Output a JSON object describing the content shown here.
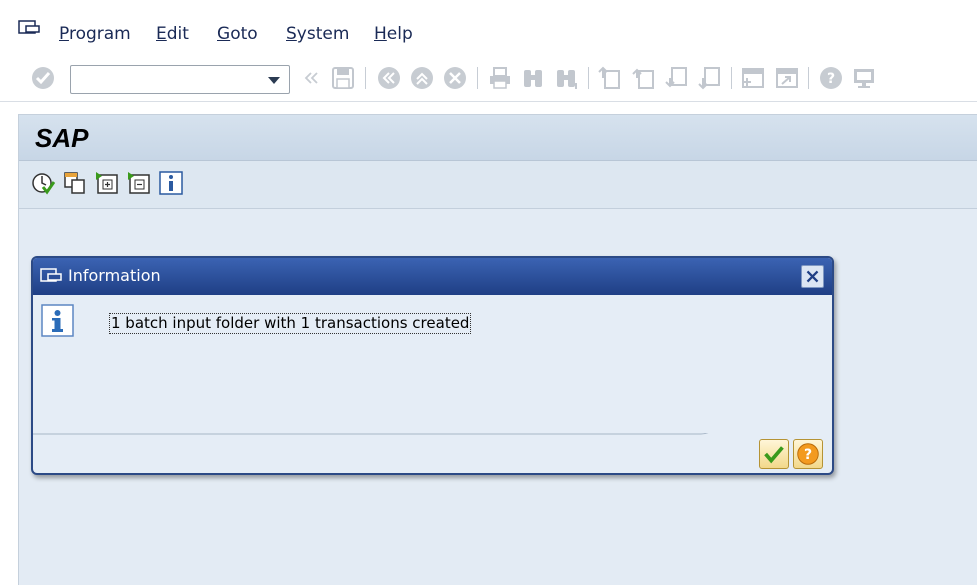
{
  "menubar": {
    "items": [
      {
        "label": "Program"
      },
      {
        "label": "Edit"
      },
      {
        "label": "Goto"
      },
      {
        "label": "System"
      },
      {
        "label": "Help"
      }
    ]
  },
  "toolbar": {
    "command_field_value": "",
    "icons": [
      "enter-icon",
      "back-nav-icon",
      "save-icon",
      "back-icon",
      "exit-icon",
      "cancel-icon",
      "print-icon",
      "find-icon",
      "find-next-icon",
      "first-page-icon",
      "previous-page-icon",
      "next-page-icon",
      "last-page-icon",
      "create-session-icon",
      "shortcut-icon",
      "help-icon",
      "customize-layout-icon"
    ]
  },
  "screen": {
    "title": "SAP",
    "app_icons": [
      "execute-icon",
      "copy-icon",
      "import-icon",
      "export-icon",
      "info-icon"
    ]
  },
  "dialog": {
    "title": "Information",
    "message": "1 batch input folder with 1 transactions created",
    "accent": "#2c4a86"
  }
}
